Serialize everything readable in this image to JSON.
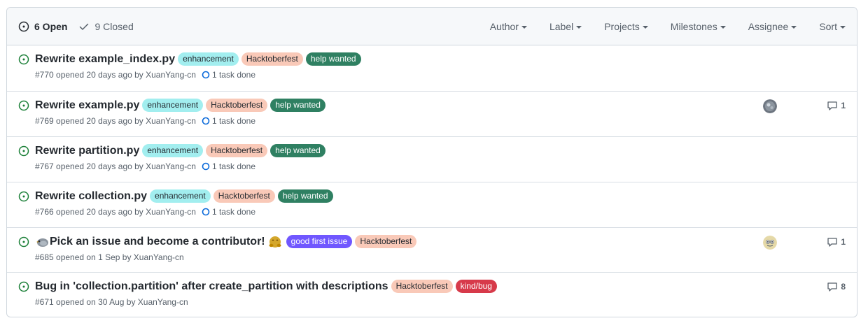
{
  "header": {
    "open_label": "6 Open",
    "closed_label": "9 Closed",
    "filters": [
      "Author",
      "Label",
      "Projects",
      "Milestones",
      "Assignee",
      "Sort"
    ]
  },
  "issues": [
    {
      "title": "Rewrite example_index.py",
      "labels": [
        "enhancement",
        "Hacktoberfest",
        "help wanted"
      ],
      "meta": "#770 opened 20 days ago by XuanYang-cn",
      "task": "1 task done"
    },
    {
      "title": "Rewrite example.py",
      "labels": [
        "enhancement",
        "Hacktoberfest",
        "help wanted"
      ],
      "meta": "#769 opened 20 days ago by XuanYang-cn",
      "task": "1 task done",
      "comments": "1"
    },
    {
      "title": "Rewrite partition.py",
      "labels": [
        "enhancement",
        "Hacktoberfest",
        "help wanted"
      ],
      "meta": "#767 opened 20 days ago by XuanYang-cn",
      "task": "1 task done"
    },
    {
      "title": "Rewrite collection.py",
      "labels": [
        "enhancement",
        "Hacktoberfest",
        "help wanted"
      ],
      "meta": "#766 opened 20 days ago by XuanYang-cn",
      "task": "1 task done"
    },
    {
      "title": "Pick an issue and become a contributor!",
      "labels": [
        "good first issue",
        "Hacktoberfest"
      ],
      "meta": "#685 opened on 1 Sep by XuanYang-cn",
      "comments": "1"
    },
    {
      "title": "Bug in 'collection.partition' after create_partition with descriptions",
      "labels": [
        "Hacktoberfest",
        "kind/bug"
      ],
      "meta": "#671 opened on 30 Aug by XuanYang-cn",
      "comments": "8"
    }
  ],
  "colors": {
    "open_green": "#1a7f37",
    "enhancement_bg": "#a2eeef",
    "enhancement_fg": "#24292f",
    "hacktoberfest_bg": "#f9c9b8",
    "hacktoberfest_fg": "#24292f",
    "help_wanted_bg": "#2f8062",
    "help_wanted_fg": "#ffffff",
    "good_first_issue_bg": "#7057ff",
    "good_first_issue_fg": "#ffffff",
    "kind_bug_bg": "#d73a4a",
    "kind_bug_fg": "#ffffff",
    "task_blue": "#0969da"
  },
  "icons": {
    "open": "issue-opened-icon",
    "closed": "check-icon",
    "task": "task-progress-icon",
    "comment": "comment-icon",
    "bird": "bird-emoji-icon",
    "hugging": "hugging-face-emoji-icon"
  }
}
